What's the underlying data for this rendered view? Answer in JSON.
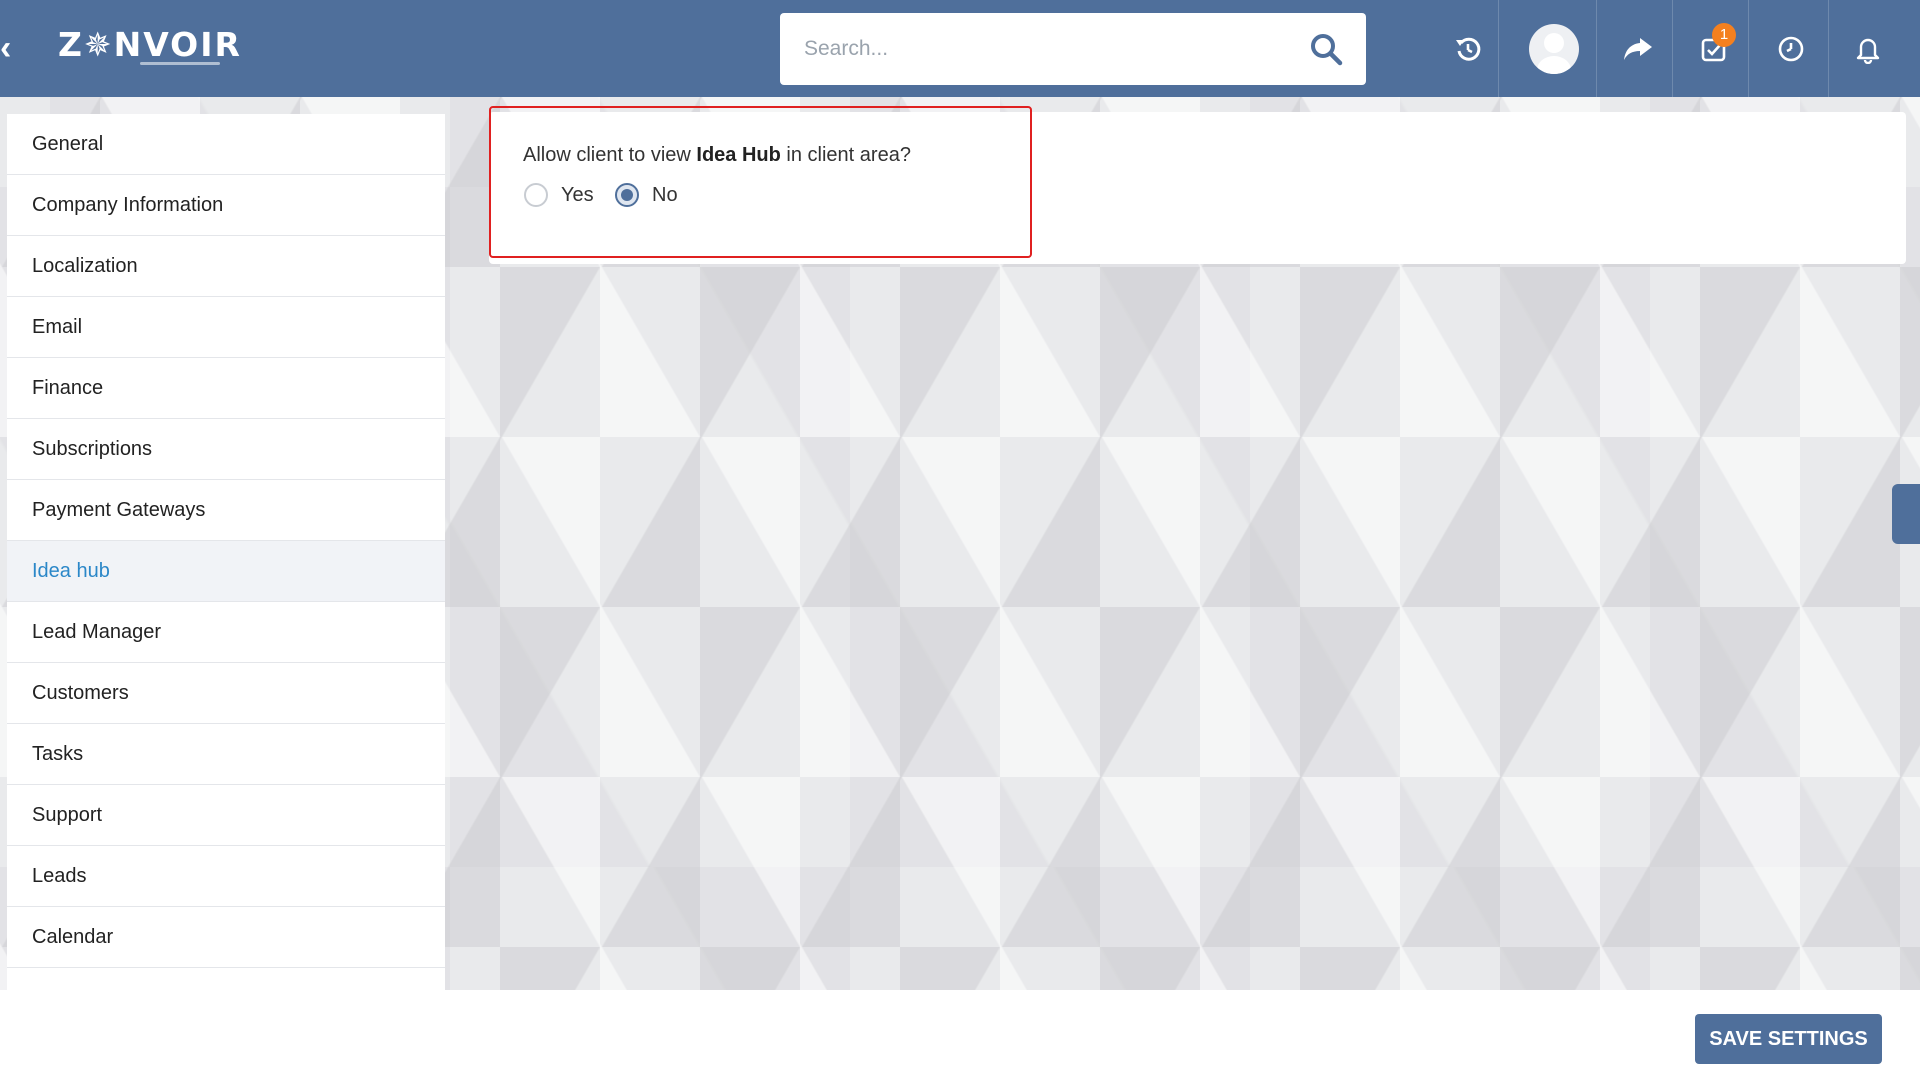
{
  "header": {
    "logo_text": "Z✵NVOIR",
    "search_placeholder": "Search...",
    "notification_badge": "1",
    "icons": [
      "back-chevron-icon",
      "search-icon",
      "history-icon",
      "avatar",
      "share-icon",
      "tasks-icon",
      "clock-icon",
      "bell-icon"
    ]
  },
  "sidebar": {
    "items": [
      {
        "label": "General"
      },
      {
        "label": "Company Information"
      },
      {
        "label": "Localization"
      },
      {
        "label": "Email"
      },
      {
        "label": "Finance"
      },
      {
        "label": "Subscriptions"
      },
      {
        "label": "Payment Gateways"
      },
      {
        "label": "Idea hub",
        "active": true
      },
      {
        "label": "Lead Manager"
      },
      {
        "label": "Customers"
      },
      {
        "label": "Tasks"
      },
      {
        "label": "Support"
      },
      {
        "label": "Leads"
      },
      {
        "label": "Calendar"
      }
    ]
  },
  "settings": {
    "question_prefix": "Allow client to view ",
    "question_bold": "Idea Hub",
    "question_suffix": " in client area?",
    "options": [
      {
        "label": "Yes",
        "checked": false
      },
      {
        "label": "No",
        "checked": true
      }
    ]
  },
  "footer": {
    "save_label": "SAVE SETTINGS"
  },
  "colors": {
    "header": "#4f6f9b",
    "active_text": "#2b87c8",
    "highlight_border": "#e02020",
    "badge": "#f4801f"
  }
}
